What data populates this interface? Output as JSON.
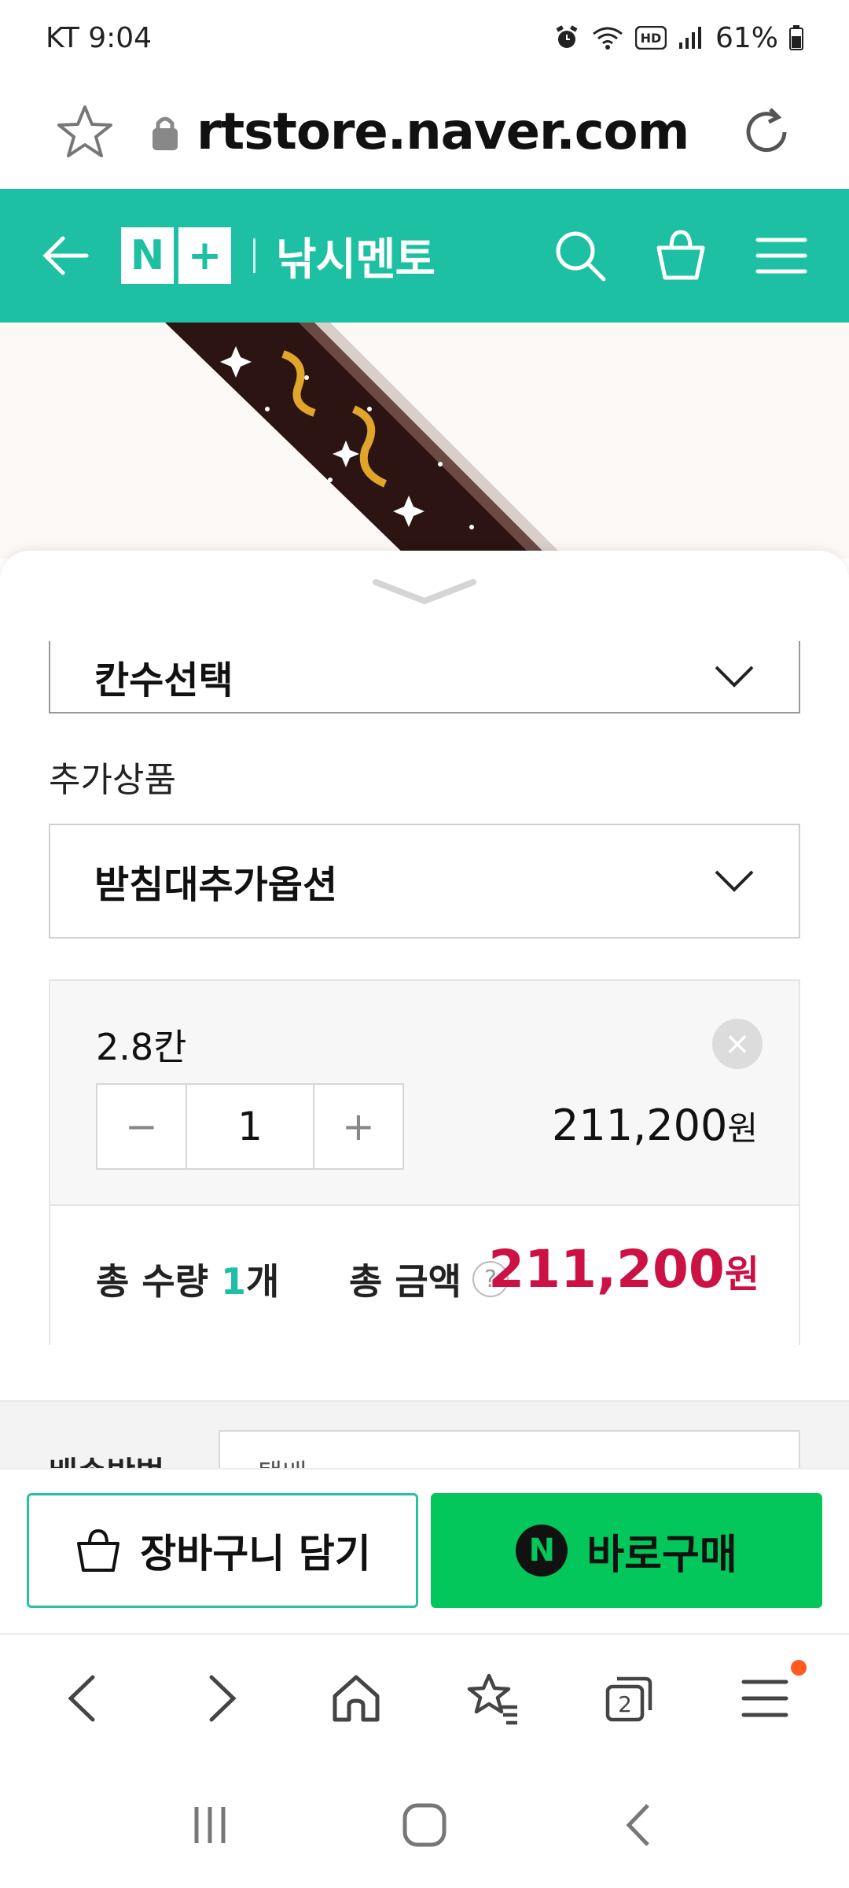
{
  "status_bar": {
    "carrier_time": "KT 9:04",
    "battery": "61%"
  },
  "browser": {
    "url": "rtstore.naver.com"
  },
  "store_header": {
    "logo_left": "N",
    "logo_right": "+",
    "store_name": "낚시멘토"
  },
  "sheet": {
    "option_select_label": "칸수선택",
    "addon_section_label": "추가상품",
    "addon_select_label": "받침대추가옵션",
    "selected_option": {
      "name": "2.8칸",
      "minus": "−",
      "quantity": "1",
      "plus": "+",
      "remove": "×",
      "price": "211,200",
      "price_unit": "원"
    },
    "totals": {
      "qty_label": "총 수량",
      "qty_value": "1",
      "qty_unit": "개",
      "amount_label": "총 금액",
      "help": "?",
      "amount_value": "211,200",
      "amount_unit": "원"
    },
    "shipping_label": "배송방법",
    "shipping_value": "택배"
  },
  "actions": {
    "cart_label": "장바구니 담기",
    "buy_badge": "N",
    "buy_label": "바로구매"
  },
  "colors": {
    "brand": "#1ec0a3",
    "buy": "#03c75a",
    "price": "#cc1144"
  }
}
